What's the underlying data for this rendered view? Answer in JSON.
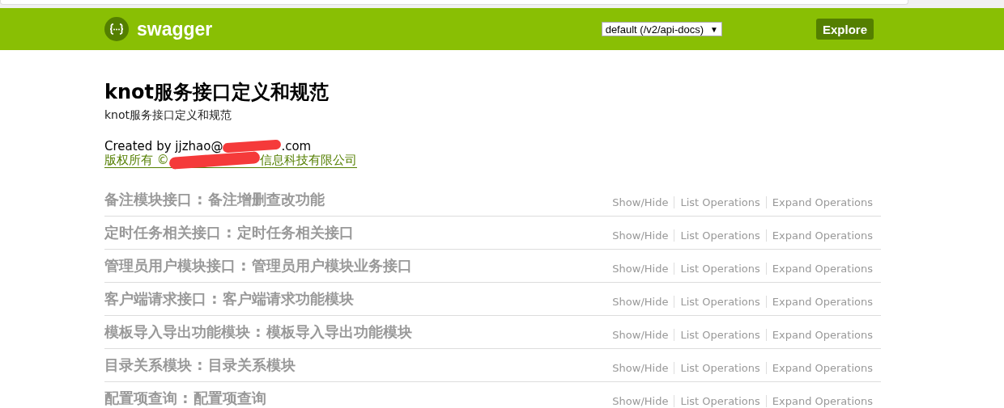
{
  "header": {
    "logo_text": "swagger",
    "api_select": {
      "value": "default (/v2/api-docs)",
      "arrow": "▼"
    },
    "explore_button": "Explore"
  },
  "info": {
    "title": "knot服务接口定义和规范",
    "description": "knot服务接口定义和规范",
    "created_by": {
      "before": "Created by jjzhao@",
      "after": ".com"
    },
    "copyright": {
      "before": "版权所有 ©",
      "after": "信息科技有限公司"
    }
  },
  "resources": [
    {
      "name": "备注模块接口 : 备注增删查改功能",
      "actions": [
        "Show/Hide",
        "List Operations",
        "Expand Operations"
      ]
    },
    {
      "name": "定时任务相关接口 : 定时任务相关接口",
      "actions": [
        "Show/Hide",
        "List Operations",
        "Expand Operations"
      ]
    },
    {
      "name": "管理员用户模块接口 : 管理员用户模块业务接口",
      "actions": [
        "Show/Hide",
        "List Operations",
        "Expand Operations"
      ]
    },
    {
      "name": "客户端请求接口 : 客户端请求功能模块",
      "actions": [
        "Show/Hide",
        "List Operations",
        "Expand Operations"
      ]
    },
    {
      "name": "模板导入导出功能模块 : 模板导入导出功能模块",
      "actions": [
        "Show/Hide",
        "List Operations",
        "Expand Operations"
      ]
    },
    {
      "name": "目录关系模块 : 目录关系模块",
      "actions": [
        "Show/Hide",
        "List Operations",
        "Expand Operations"
      ]
    },
    {
      "name": "配置项查询 : 配置项查询",
      "actions": [
        "Show/Hide",
        "List Operations",
        "Expand Operations"
      ]
    }
  ]
}
